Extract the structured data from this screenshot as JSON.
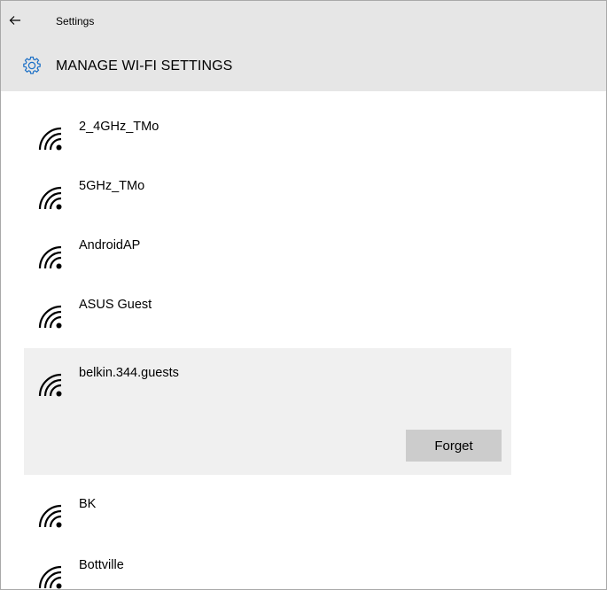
{
  "app": {
    "title": "Settings"
  },
  "page": {
    "title": "MANAGE WI-FI SETTINGS"
  },
  "icons": {
    "back": "back-arrow-icon",
    "settings": "gear-icon",
    "network": "wifi-signal-icon"
  },
  "networks": [
    {
      "name": "2_4GHz_TMo",
      "selected": false
    },
    {
      "name": "5GHz_TMo",
      "selected": false
    },
    {
      "name": "AndroidAP",
      "selected": false
    },
    {
      "name": "ASUS Guest",
      "selected": false
    },
    {
      "name": "belkin.344.guests",
      "selected": true,
      "action_label": "Forget"
    },
    {
      "name": "BK",
      "selected": false
    },
    {
      "name": "Bottville",
      "selected": false
    }
  ],
  "colors": {
    "header_bg": "#e6e6e6",
    "selected_bg": "#f0f0f0",
    "button_bg": "#cccccc",
    "accent": "#1a6fc6"
  }
}
